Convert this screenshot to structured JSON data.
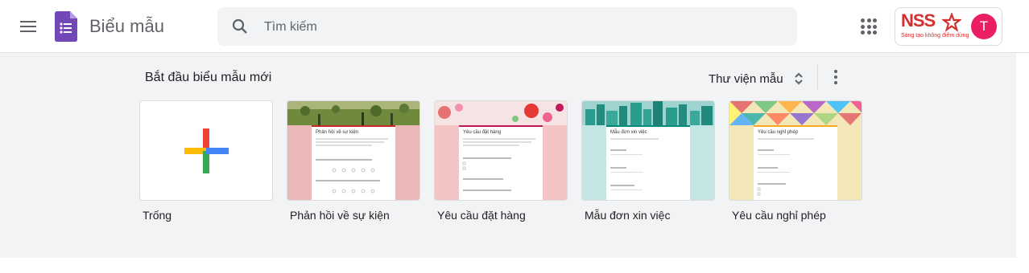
{
  "header": {
    "app_title": "Biểu mẫu",
    "search": {
      "placeholder": "Tìm kiếm"
    },
    "account": {
      "brand": "NSS",
      "tagline": "Sáng tạo không điểm dừng",
      "avatar_letter": "T"
    }
  },
  "gallery": {
    "title": "Bắt đầu biểu mẫu mới",
    "library_label": "Thư viện mẫu",
    "templates": [
      {
        "label": "Trống"
      },
      {
        "label": "Phản hồi về sự kiện",
        "preview_title": "Phản hồi về sự kiện"
      },
      {
        "label": "Yêu cầu đặt hàng",
        "preview_title": "Yêu cầu đặt hàng"
      },
      {
        "label": "Mẫu đơn xin việc",
        "preview_title": "Mẫu đơn xin việc"
      },
      {
        "label": "Yêu cầu nghỉ phép",
        "preview_title": "Yêu cầu nghỉ phép"
      }
    ]
  },
  "colors": {
    "accent_purple": "#7248b9",
    "brand_red": "#d32f2f",
    "avatar_pink": "#e91e63",
    "gallery_bg": "#f1f3f4"
  },
  "icons": [
    "menu-icon",
    "forms-logo-icon",
    "search-icon",
    "apps-grid-icon",
    "star-icon",
    "sort-arrows-icon",
    "more-vert-icon",
    "plus-icon"
  ]
}
